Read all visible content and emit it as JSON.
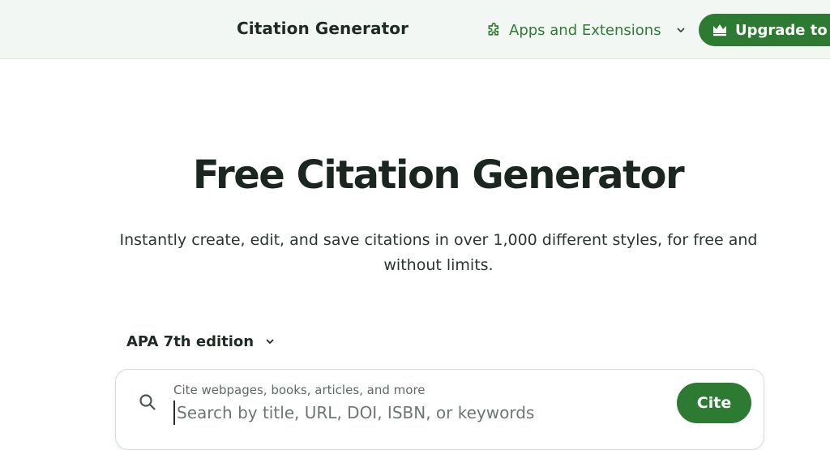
{
  "header": {
    "title": "Citation Generator",
    "apps_menu_label": "Apps and Extensions",
    "apps_menu_icon": "puzzle-icon",
    "upgrade_label": "Upgrade to Pro",
    "upgrade_icon": "crown-icon"
  },
  "hero": {
    "title": "Free Citation Generator",
    "subtitle": "Instantly create, edit, and save citations in over 1,000 different styles, for free and without limits."
  },
  "style_selector": {
    "selected": "APA 7th edition"
  },
  "search": {
    "label": "Cite webpages, books, articles, and more",
    "placeholder": "Search by title, URL, DOI, ISBN, or keywords",
    "value": "",
    "button_label": "Cite"
  },
  "colors": {
    "brand_green": "#2d7a32",
    "header_bg": "#f3f7f4",
    "text_dark": "#1b2620"
  }
}
